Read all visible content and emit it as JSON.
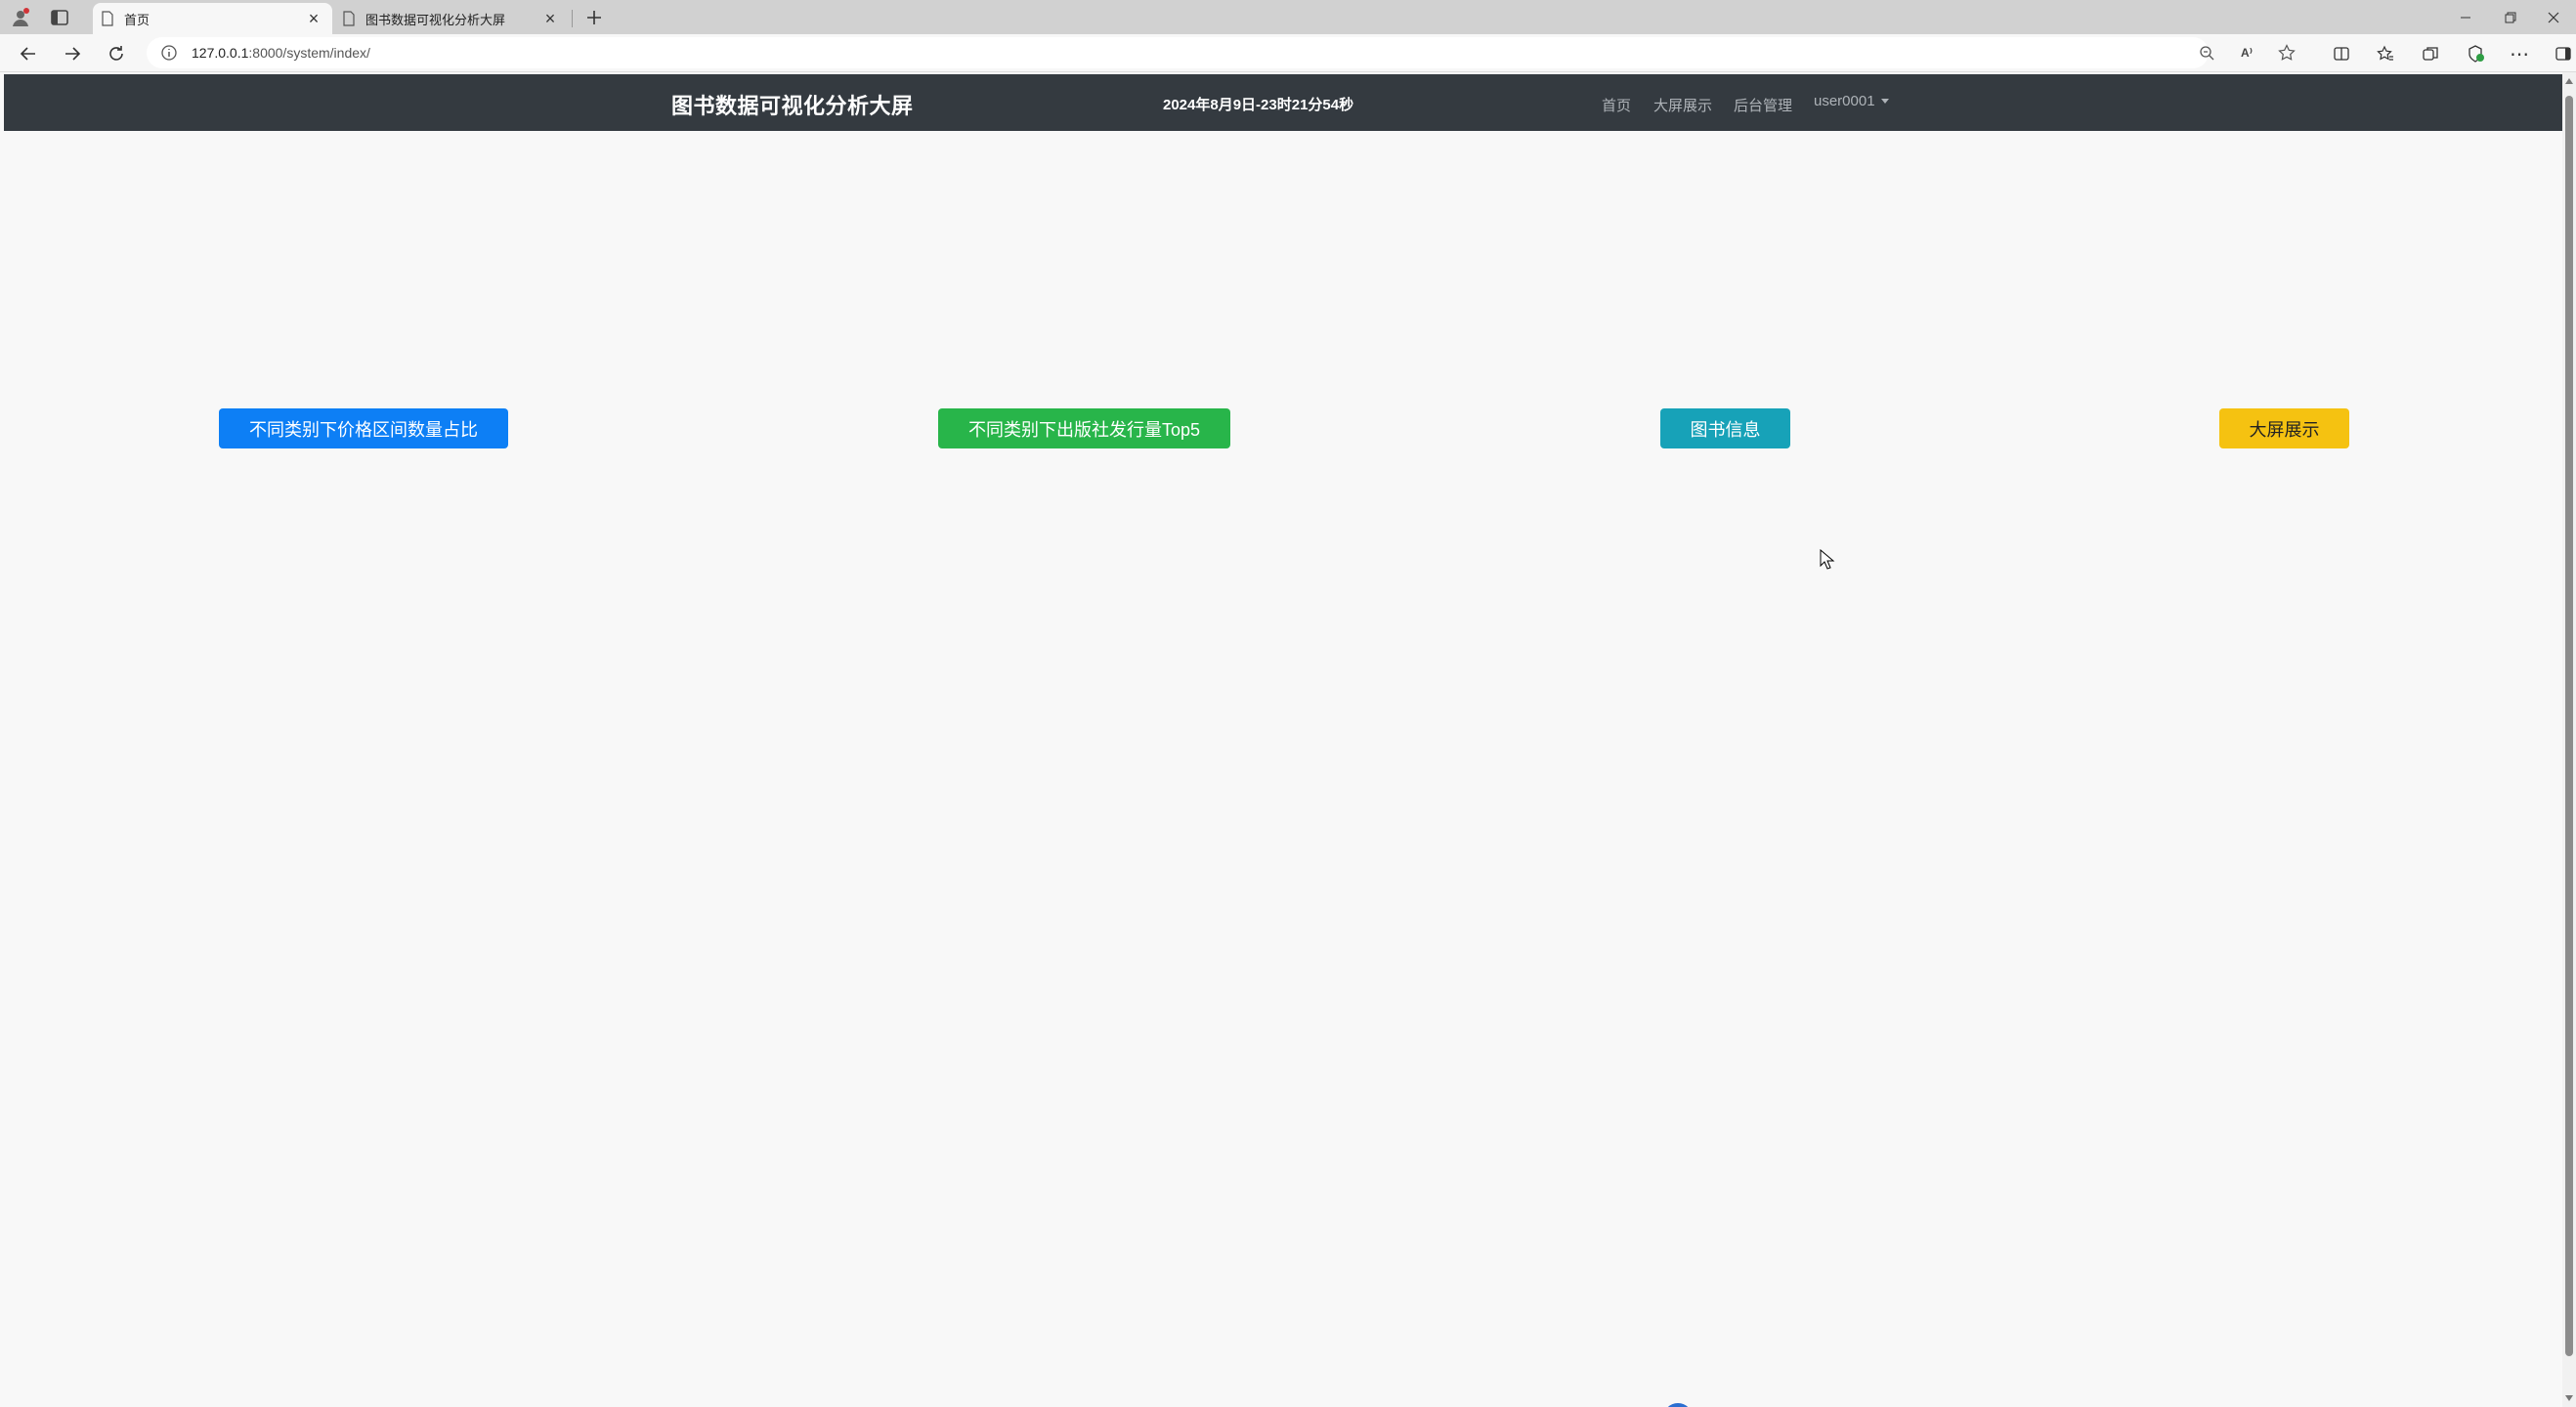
{
  "browser": {
    "tabs": [
      {
        "title": "首页",
        "active": true
      },
      {
        "title": "图书数据可视化分析大屏",
        "active": false
      }
    ],
    "address": {
      "host": "127.0.0.1",
      "path": ":8000/system/index/"
    },
    "icons": {
      "profile": "profile-icon",
      "tab_actions": "tabs-icon",
      "read_aloud_label": "A⁾"
    }
  },
  "navbar": {
    "brand": "图书数据可视化分析大屏",
    "clock": "2024年8月9日-23时21分54秒",
    "links": [
      "首页",
      "大屏展示",
      "后台管理"
    ],
    "user": "user0001"
  },
  "actions": {
    "price_share": "不同类别下价格区间数量占比",
    "publisher_top5": "不同类别下出版社发行量Top5",
    "book_info": "图书信息",
    "big_screen": "大屏展示"
  },
  "colors": {
    "navbar_bg": "#343a40",
    "primary": "#0d7ff5",
    "success": "#28b54a",
    "info": "#17a2b8",
    "warning": "#f5c211",
    "page_bg": "#f8f8f8"
  }
}
